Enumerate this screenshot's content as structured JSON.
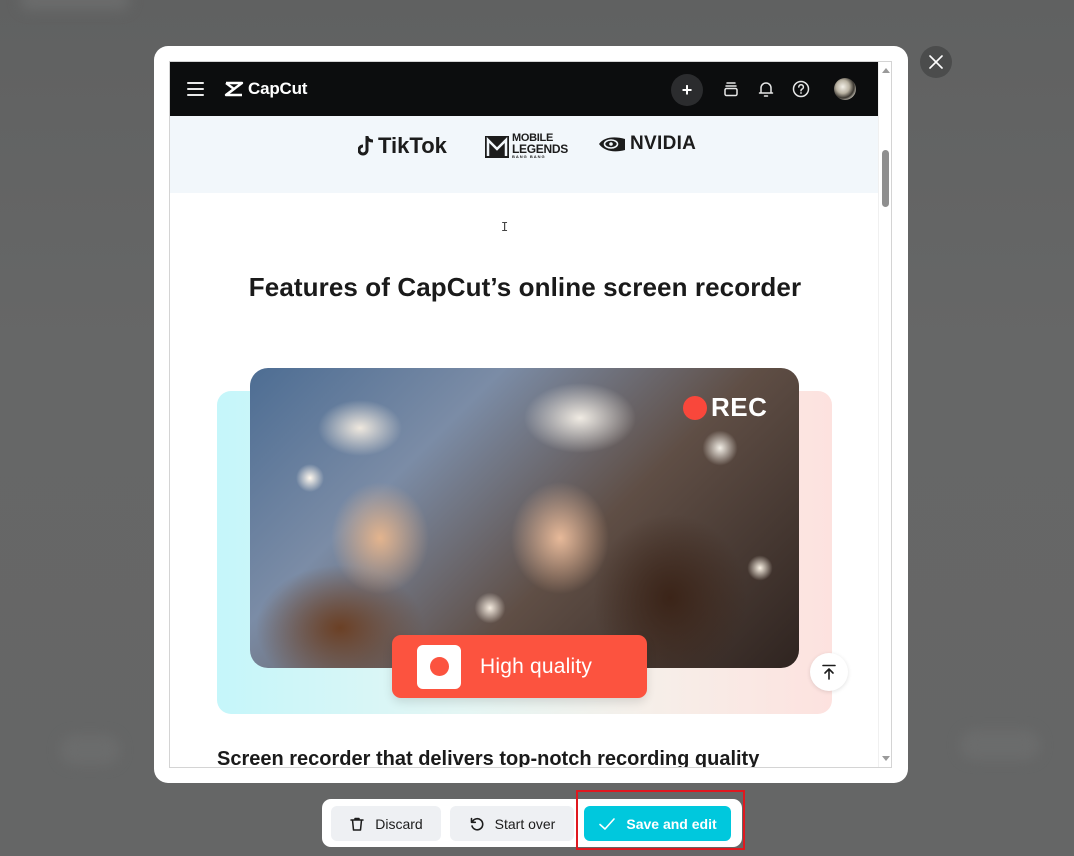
{
  "modal": {
    "close_icon": "close-icon"
  },
  "capcut_header": {
    "menu_icon": "hamburger-menu-icon",
    "logo_text": "CapCut",
    "create_label": "+",
    "icons": [
      "plus-icon",
      "stack-icon",
      "bell-icon",
      "help-icon",
      "avatar"
    ]
  },
  "brands": {
    "tiktok": "TikTok",
    "mobile_legends_line1": "MOBILE",
    "mobile_legends_line2": "LEGENDS",
    "mobile_legends_line3": "BANG BANG",
    "nvidia": "NVIDIA"
  },
  "content": {
    "text_cursor": "I",
    "features_title": "Features of CapCut’s online screen recorder",
    "rec_label": "REC",
    "high_quality_label": "High quality",
    "sub_heading": "Screen recorder that delivers top-notch recording quality"
  },
  "actions": {
    "discard_label": "Discard",
    "start_over_label": "Start over",
    "save_and_edit_label": "Save and edit"
  },
  "colors": {
    "accent_cyan": "#00c8dd",
    "rec_red": "#fc533f",
    "highlight_red": "#e0181f",
    "header_black": "#0c0d0e"
  }
}
